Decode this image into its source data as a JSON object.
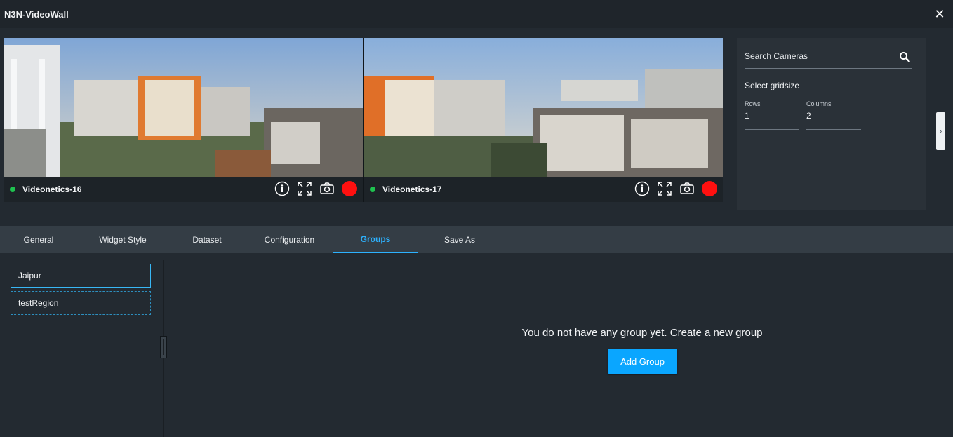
{
  "window": {
    "title": "N3N-VideoWall",
    "close_icon": "close-icon"
  },
  "cameras": [
    {
      "name": "Videonetics-16",
      "status": "online",
      "status_color": "#1ec24f"
    },
    {
      "name": "Videonetics-17",
      "status": "online",
      "status_color": "#1ec24f"
    }
  ],
  "side_panel": {
    "search_label": "Search Cameras",
    "gridsize_label": "Select gridsize",
    "rows_label": "Rows",
    "rows_value": "1",
    "columns_label": "Columns",
    "columns_value": "2",
    "collapse_glyph": "›"
  },
  "tabs": [
    {
      "label": "General",
      "active": false
    },
    {
      "label": "Widget Style",
      "active": false
    },
    {
      "label": "Dataset",
      "active": false
    },
    {
      "label": "Configuration",
      "active": false
    },
    {
      "label": "Groups",
      "active": true
    },
    {
      "label": "Save As",
      "active": false
    }
  ],
  "regions": [
    {
      "label": "Jaipur",
      "selected": true
    },
    {
      "label": "testRegion",
      "selected": false
    }
  ],
  "groups": {
    "empty_message": "You do not have any group yet. Create a new group",
    "add_button": "Add Group"
  },
  "colors": {
    "accent": "#2db2ff",
    "button": "#0aa6ff",
    "record": "#ff1010"
  }
}
